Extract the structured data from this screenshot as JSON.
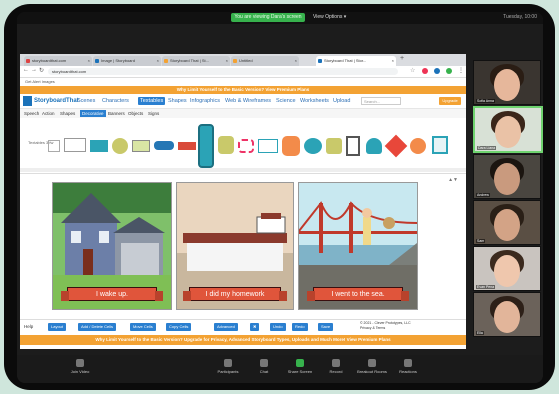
{
  "zoom": {
    "share_pill": "You are viewing Dara's screen",
    "view_options": "View Options ▾",
    "top_right": "Tuesday, 10:00",
    "controls": [
      {
        "label": "Join Video",
        "icon": "video-icon"
      },
      {
        "label": "Participants",
        "icon": "participants-icon"
      },
      {
        "label": "Chat",
        "icon": "chat-icon"
      },
      {
        "label": "Share Screen",
        "icon": "share-screen-icon"
      },
      {
        "label": "Record",
        "icon": "record-icon"
      },
      {
        "label": "Breakout Rooms",
        "icon": "breakout-icon"
      },
      {
        "label": "Reactions",
        "icon": "reactions-icon"
      }
    ]
  },
  "browser": {
    "tabs": [
      "storyboardthat.com",
      "Image | Storyboard",
      "Storyboard That | St...",
      "Untitled",
      "Storyboard That | Stor..."
    ],
    "url": "storyboardthat.com",
    "bookmark": "Get Alert Images"
  },
  "storyboard": {
    "promo": "Why Limit Yourself to the Basic Version? View Premium Plans",
    "logo": "StoryboardThat",
    "nav": [
      "Scenes",
      "Characters",
      "Textables",
      "Shapes",
      "Infographics",
      "Web & Wireframes",
      "Science",
      "Worksheets",
      "Upload"
    ],
    "active_nav": "Textables",
    "search_placeholder": "Search...",
    "upgrade": "Upgrade",
    "subnav": [
      "Speech",
      "Action",
      "Shapes",
      "Decorative",
      "Banners",
      "Objects",
      "Signs"
    ],
    "active_subnav": "Decorative",
    "shelf_label": "Textables 3 fw",
    "cells": [
      {
        "caption": "I wake up."
      },
      {
        "caption": "I did my homework"
      },
      {
        "caption": "I went to the sea."
      }
    ],
    "toolbar": {
      "help": "Help",
      "layout": "Layout",
      "add_delete": "Add / Delete Cells",
      "move": "Move Cells",
      "copy": "Copy Cells",
      "advanced": "Advanced",
      "undo": "Undo",
      "redo": "Redo",
      "save": "Save",
      "copyright_1": "© 2021 - Clever Prototypes, LLC",
      "copyright_2": "Privacy & Terms"
    },
    "bottom_banner": "Why Limit Yourself to the Basic Version? Upgrade for Privacy, Advanced Storyboard Types, Uploads and Much More! View Premium Plans"
  },
  "participants": [
    {
      "name": "Sofia Anna"
    },
    {
      "name": "Dara Liana"
    },
    {
      "name": "Andrew"
    },
    {
      "name": "Sam"
    },
    {
      "name": "Evan Pena"
    },
    {
      "name": "Ella"
    },
    {
      "name": "Sofia Xu"
    }
  ]
}
